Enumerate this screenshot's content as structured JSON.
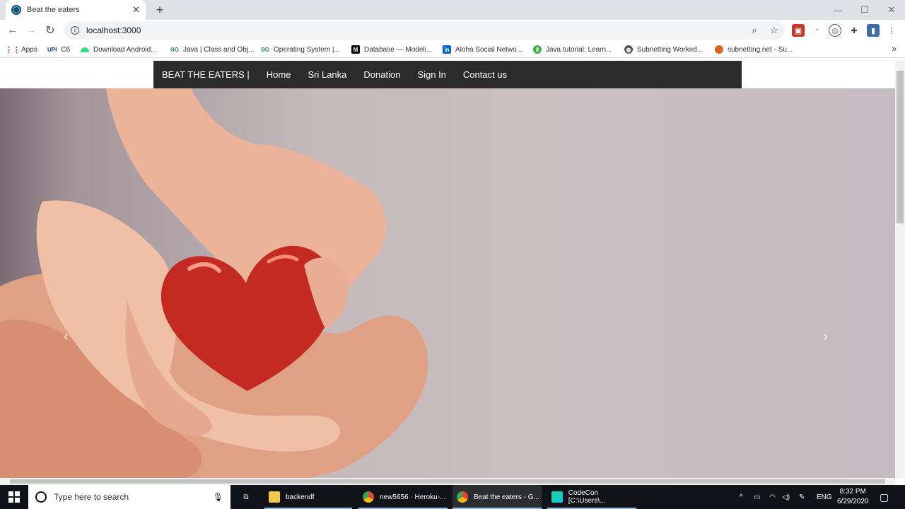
{
  "browser": {
    "tab_title": "Beat the eaters",
    "url": "localhost:3000",
    "bookmarks": [
      {
        "label": "Apps",
        "icon": "apps-grid-icon"
      },
      {
        "label": "C6",
        "icon": "upi-icon"
      },
      {
        "label": "Download Android...",
        "icon": "android-icon"
      },
      {
        "label": "Java | Class and Obj...",
        "icon": "gfg-icon"
      },
      {
        "label": "Operating System |...",
        "icon": "gfg-icon"
      },
      {
        "label": "Database — Modeli...",
        "icon": "medium-icon"
      },
      {
        "label": "Aloha Social Netwo...",
        "icon": "linkedin-icon"
      },
      {
        "label": "Java tutorial: Learn...",
        "icon": "globe-green-icon"
      },
      {
        "label": "Subnetting Worked...",
        "icon": "globe-icon"
      },
      {
        "label": "subnetting.net - Su...",
        "icon": "ball-icon"
      }
    ],
    "upi_label": "UPI"
  },
  "site": {
    "brand": "BEAT THE EATERS |",
    "nav": [
      "Home",
      "Sri Lanka",
      "Donation",
      "Sign In",
      "Contact us"
    ]
  },
  "taskbar": {
    "search_placeholder": "Type here to search",
    "tasks": [
      "backendf",
      "new5656 · Heroku-...",
      "Beat the eaters - G...",
      "CodeCon [C:\\Users\\..."
    ],
    "lang": "ENG",
    "time": "8:32 PM",
    "date": "6/29/2020"
  },
  "colors": {
    "navbar": "#2b2b2b",
    "accent": "#8fb4e0"
  }
}
